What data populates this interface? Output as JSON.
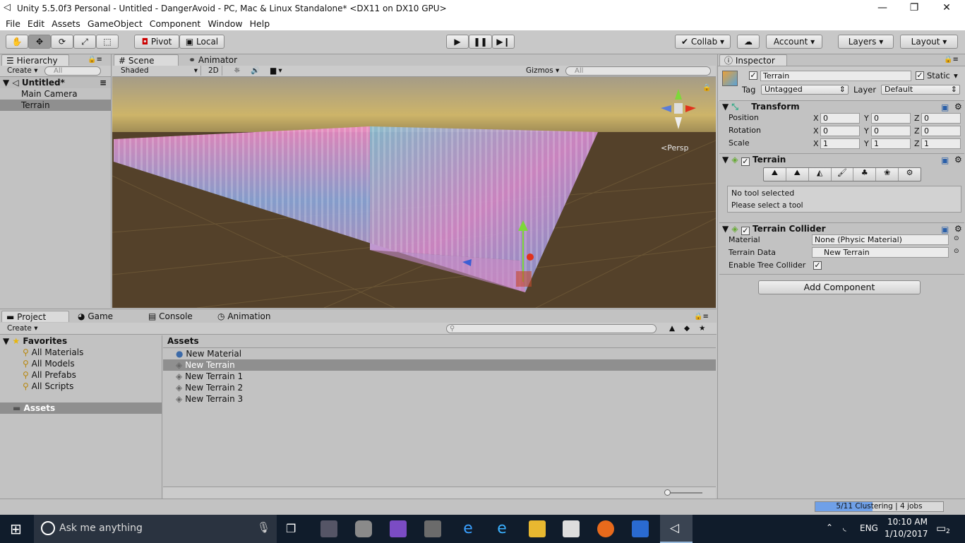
{
  "window": {
    "title": "Unity 5.5.0f3 Personal - Untitled - DangerAvoid - PC, Mac & Linux Standalone* <DX11 on DX10 GPU>",
    "minimize": "—",
    "maximize": "❐",
    "close": "✕"
  },
  "menu": [
    "File",
    "Edit",
    "Assets",
    "GameObject",
    "Component",
    "Window",
    "Help"
  ],
  "toolbar": {
    "pivot": "Pivot",
    "local": "Local",
    "collab": "Collab",
    "account": "Account",
    "layers": "Layers",
    "layout": "Layout"
  },
  "hierarchy": {
    "tab": "Hierarchy",
    "create": "Create",
    "search_placeholder": "All",
    "scene": "Untitled*",
    "items": [
      "Main Camera",
      "Terrain"
    ]
  },
  "scene": {
    "tab_scene": "Scene",
    "tab_animator": "Animator",
    "shading": "Shaded",
    "mode2d": "2D",
    "gizmos": "Gizmos",
    "search_placeholder": "All",
    "persp": "Persp"
  },
  "project": {
    "tabs": [
      "Project",
      "Game",
      "Console",
      "Animation"
    ],
    "create": "Create",
    "favorites_label": "Favorites",
    "favorites": [
      "All Materials",
      "All Models",
      "All Prefabs",
      "All Scripts"
    ],
    "assets_label": "Assets",
    "assets_header": "Assets",
    "assets": [
      "New Material",
      "New Terrain",
      "New Terrain 1",
      "New Terrain 2",
      "New Terrain 3"
    ]
  },
  "inspector": {
    "tab": "Inspector",
    "object_name": "Terrain",
    "static_label": "Static",
    "tag_label": "Tag",
    "tag_value": "Untagged",
    "layer_label": "Layer",
    "layer_value": "Default",
    "transform": {
      "title": "Transform",
      "rows": [
        {
          "label": "Position",
          "x": "0",
          "y": "0",
          "z": "0"
        },
        {
          "label": "Rotation",
          "x": "0",
          "y": "0",
          "z": "0"
        },
        {
          "label": "Scale",
          "x": "1",
          "y": "1",
          "z": "1"
        }
      ]
    },
    "terrain": {
      "title": "Terrain",
      "msg1": "No tool selected",
      "msg2": "Please select a tool"
    },
    "collider": {
      "title": "Terrain Collider",
      "material_label": "Material",
      "material_value": "None (Physic Material)",
      "data_label": "Terrain Data",
      "data_value": "New Terrain",
      "tree_label": "Enable Tree Collider"
    },
    "add_component": "Add Component"
  },
  "status": {
    "progress_text": "5/11 Clustering | 4 jobs",
    "progress": 0.45
  },
  "taskbar": {
    "search_placeholder": "Ask me anything",
    "lang": "ENG",
    "time": "10:10 AM",
    "date": "1/10/2017",
    "notif_count": "2"
  }
}
